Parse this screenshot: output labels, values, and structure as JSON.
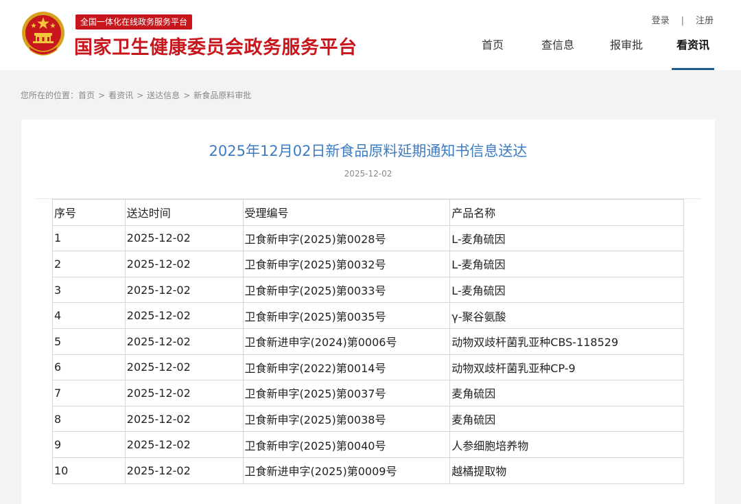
{
  "header": {
    "platform_tag": "全国一体化在线政务服务平台",
    "site_title": "国家卫生健康委员会政务服务平台",
    "emblem_icon": "national-emblem-icon",
    "brand_color": "#c8161d",
    "account": {
      "login": "登录",
      "separator": "|",
      "register": "注册"
    },
    "nav": [
      {
        "label": "首页",
        "active": false
      },
      {
        "label": "查信息",
        "active": false
      },
      {
        "label": "报审批",
        "active": false
      },
      {
        "label": "看资讯",
        "active": true
      }
    ],
    "nav_active_color": "#1f5a8c"
  },
  "breadcrumb": {
    "prefix": "您所在的位置：",
    "items": [
      "首页",
      "看资讯",
      "送达信息",
      "新食品原料审批"
    ],
    "separator": ">"
  },
  "article": {
    "title": "2025年12月02日新食品原料延期通知书信息送达",
    "date": "2025-12-02",
    "title_color": "#3d7bc3"
  },
  "table": {
    "headers": [
      "序号",
      "送达时间",
      "受理编号",
      "产品名称"
    ],
    "rows": [
      [
        "1",
        "2025-12-02",
        "卫食新申字(2025)第0028号",
        "L-麦角硫因"
      ],
      [
        "2",
        "2025-12-02",
        "卫食新申字(2025)第0032号",
        "L-麦角硫因"
      ],
      [
        "3",
        "2025-12-02",
        "卫食新申字(2025)第0033号",
        "L-麦角硫因"
      ],
      [
        "4",
        "2025-12-02",
        "卫食新申字(2025)第0035号",
        "γ-聚谷氨酸"
      ],
      [
        "5",
        "2025-12-02",
        "卫食新进申字(2024)第0006号",
        "动物双歧杆菌乳亚种CBS-118529"
      ],
      [
        "6",
        "2025-12-02",
        "卫食新申字(2022)第0014号",
        "动物双歧杆菌乳亚种CP-9"
      ],
      [
        "7",
        "2025-12-02",
        "卫食新申字(2025)第0037号",
        "麦角硫因"
      ],
      [
        "8",
        "2025-12-02",
        "卫食新申字(2025)第0038号",
        "麦角硫因"
      ],
      [
        "9",
        "2025-12-02",
        "卫食新申字(2025)第0040号",
        "人参细胞培养物"
      ],
      [
        "10",
        "2025-12-02",
        "卫食新进申字(2025)第0009号",
        "越橘提取物"
      ]
    ]
  }
}
